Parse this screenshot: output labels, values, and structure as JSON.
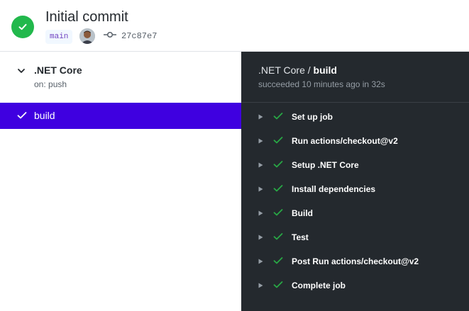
{
  "colors": {
    "accent_green": "#22b84c",
    "selected_job_bg": "#3f00e0",
    "log_panel_bg": "#24292e",
    "top_accent": "#f97583"
  },
  "header": {
    "status_icon": "check-circle-icon",
    "title": "Initial commit",
    "branch": "main",
    "commit_icon": "git-commit-icon",
    "sha": "27c87e7"
  },
  "workflow": {
    "name": ".NET Core",
    "trigger": "on: push",
    "jobs": [
      {
        "label": "build",
        "status": "success"
      }
    ]
  },
  "job_panel": {
    "workflow_name": ".NET Core",
    "separator": " / ",
    "job_name": "build",
    "summary": "succeeded 10 minutes ago in 32s"
  },
  "steps": [
    {
      "label": "Set up job"
    },
    {
      "label": "Run actions/checkout@v2"
    },
    {
      "label": "Setup .NET Core"
    },
    {
      "label": "Install dependencies"
    },
    {
      "label": "Build"
    },
    {
      "label": "Test"
    },
    {
      "label": "Post Run actions/checkout@v2"
    },
    {
      "label": "Complete job"
    }
  ]
}
